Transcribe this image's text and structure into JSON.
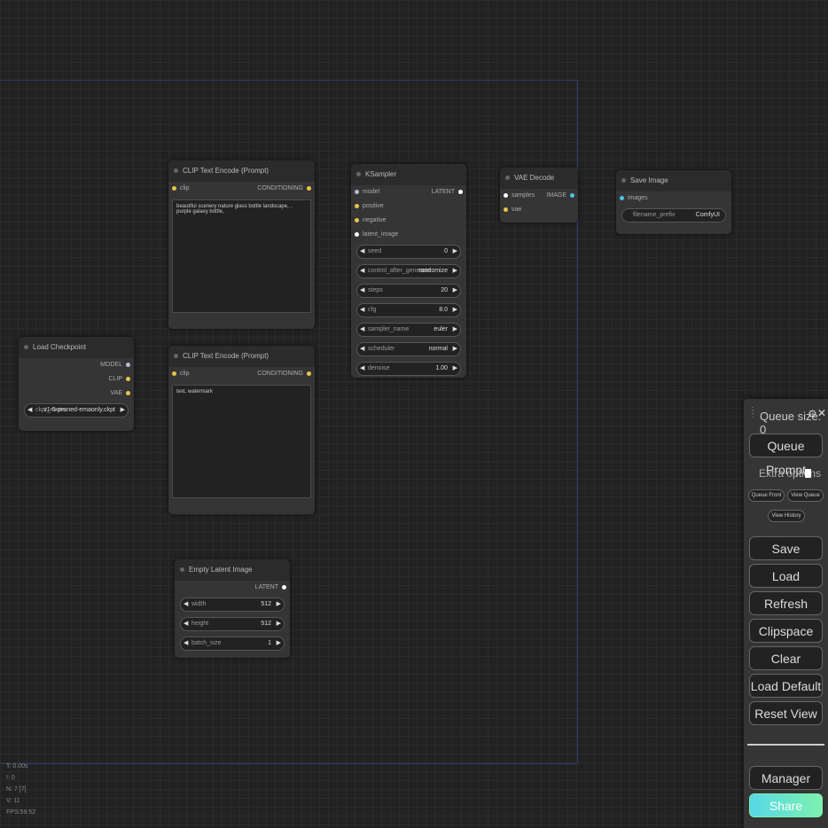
{
  "canvas": {
    "perf": {
      "t": "T: 0.00s",
      "i": "I: 0",
      "n": "N: 7 [7]",
      "v": "V: 11",
      "fps": "FPS:59.52"
    }
  },
  "nodes": {
    "clip_pos": {
      "title": "CLIP Text Encode (Prompt)",
      "input": "clip",
      "output": "CONDITIONING",
      "text": "beautiful scenery nature glass bottle landscape, , purple galaxy bottle,"
    },
    "clip_neg": {
      "title": "CLIP Text Encode (Prompt)",
      "input": "clip",
      "output": "CONDITIONING",
      "text": "text, watermark"
    },
    "ksampler": {
      "title": "KSampler",
      "inputs": [
        "model",
        "positive",
        "negative",
        "latent_image"
      ],
      "output": "LATENT",
      "widgets": [
        {
          "label": "seed",
          "value": "0"
        },
        {
          "label": "control_after_generate",
          "value": "randomize"
        },
        {
          "label": "steps",
          "value": "20"
        },
        {
          "label": "cfg",
          "value": "8.0"
        },
        {
          "label": "sampler_name",
          "value": "euler"
        },
        {
          "label": "scheduler",
          "value": "normal"
        },
        {
          "label": "denoise",
          "value": "1.00"
        }
      ]
    },
    "vae_decode": {
      "title": "VAE Decode",
      "inputs": [
        "samples",
        "vae"
      ],
      "output": "IMAGE"
    },
    "save_image": {
      "title": "Save Image",
      "input": "images",
      "widget": {
        "label": "filename_prefix",
        "value": "ComfyUI"
      }
    },
    "load_checkpoint": {
      "title": "Load Checkpoint",
      "outputs": [
        "MODEL",
        "CLIP",
        "VAE"
      ],
      "widget": {
        "label": "ckpt_name",
        "value": "v1-5-pruned-emaonly.ckpt"
      }
    },
    "empty_latent": {
      "title": "Empty Latent Image",
      "output": "LATENT",
      "widgets": [
        {
          "label": "width",
          "value": "512"
        },
        {
          "label": "height",
          "value": "512"
        },
        {
          "label": "batch_size",
          "value": "1"
        }
      ]
    }
  },
  "menu": {
    "queue_size": "Queue size: 0",
    "queue_prompt": "Queue Prompt",
    "extra_options": "Extra options",
    "queue_front": "Queue Front",
    "view_queue": "View Queue",
    "view_history": "View History",
    "save": "Save",
    "load": "Load",
    "refresh": "Refresh",
    "clipspace": "Clipspace",
    "clear": "Clear",
    "load_default": "Load Default",
    "reset_view": "Reset View",
    "manager": "Manager",
    "share": "Share"
  },
  "colors": {
    "clip_slot": "#e8c44b",
    "model_slot": "#b8b8d8",
    "latent_slot": "#ffffff",
    "image_slot": "#4fc3e8",
    "share_gradient_start": "#56d8e6",
    "share_gradient_end": "#7ef0b0"
  }
}
